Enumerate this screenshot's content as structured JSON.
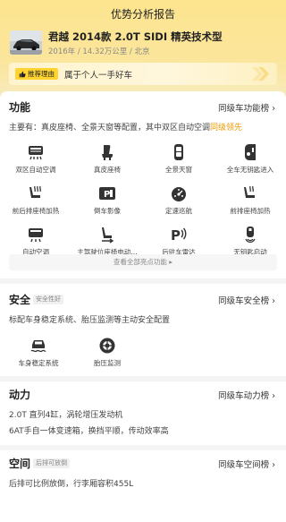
{
  "header": {
    "title": "优势分析报告",
    "car_name": "君越 2014款 2.0T SIDI 精英技术型",
    "car_meta": "2016年 / 14.32万公里 / 北京",
    "reco_badge": "推荐理由",
    "reco_text": "属于个人一手好车"
  },
  "features": {
    "title": "功能",
    "link": "同级车功能榜 ›",
    "summary_prefix": "主要有：真皮座椅、全景天窗等配置，其中双区自动空调",
    "summary_highlight": "同级领先",
    "items": [
      {
        "label": "双区自动空调",
        "icon": "dual-zone-ac-icon"
      },
      {
        "label": "真皮座椅",
        "icon": "leather-seat-icon"
      },
      {
        "label": "全景天窗",
        "icon": "panoramic-sunroof-icon"
      },
      {
        "label": "全车无钥匙进入",
        "icon": "keyless-entry-icon"
      },
      {
        "label": "前后排座椅加热",
        "icon": "seat-heating-icon"
      },
      {
        "label": "倒车影像",
        "icon": "reverse-camera-icon"
      },
      {
        "label": "定速巡航",
        "icon": "cruise-control-icon"
      },
      {
        "label": "前排座椅加热",
        "icon": "front-seat-heating-icon"
      },
      {
        "label": "自动空调",
        "icon": "auto-ac-icon"
      },
      {
        "label": "主驾驶位座椅电动…",
        "icon": "power-seat-icon"
      },
      {
        "label": "后驻车雷达",
        "icon": "rear-parking-radar-icon"
      },
      {
        "label": "无钥匙启动",
        "icon": "keyless-start-icon"
      }
    ],
    "view_all": "查看全部亮点功能 ▸"
  },
  "safety": {
    "title": "安全",
    "tag": "安全性好",
    "link": "同级车安全榜 ›",
    "summary": "标配车身稳定系统、胎压监测等主动安全配置",
    "items": [
      {
        "label": "车身稳定系统",
        "icon": "stability-control-icon"
      },
      {
        "label": "胎压监测",
        "icon": "tire-pressure-icon"
      }
    ]
  },
  "power": {
    "title": "动力",
    "link": "同级车动力榜 ›",
    "line1": "2.0T 直列4缸，涡轮增压发动机",
    "line2": "6AT手自一体变速箱，换挡平顺，传动效率高"
  },
  "space": {
    "title": "空间",
    "tag": "后排可放倒",
    "link": "同级车空间榜 ›",
    "line1": "后排可比例放倒，行李厢容积455L"
  },
  "colors": {
    "header": "#fde58f",
    "highlight": "#e89a00",
    "badge": "#ffd430"
  }
}
